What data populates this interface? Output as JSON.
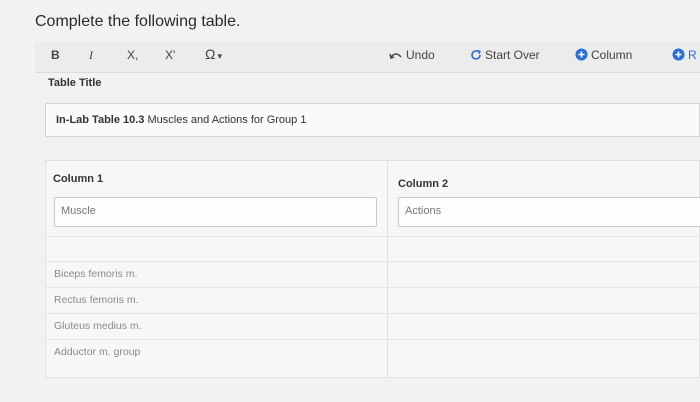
{
  "heading": "Complete the following table.",
  "toolbar": {
    "bold": "B",
    "italic": "I",
    "subscript": "X,",
    "superscript": "X'",
    "special_char": "Ω",
    "undo": "Undo",
    "start_over": "Start Over",
    "column": "Column",
    "more": "R"
  },
  "table_title_label": "Table Title",
  "table_title": {
    "bold_part": "In-Lab Table 10.3",
    "rest": " Muscles and Actions for Group 1"
  },
  "columns": [
    {
      "header": "Column 1",
      "value": "Muscle"
    },
    {
      "header": "Column 2",
      "value": "Actions"
    }
  ],
  "rows": [
    {
      "col1": "Biceps femoris m.",
      "col2": ""
    },
    {
      "col1": "Rectus femoris m.",
      "col2": ""
    },
    {
      "col1": "Gluteus medius m.",
      "col2": ""
    },
    {
      "col1": "Adductor m. group",
      "col2": ""
    }
  ],
  "colors": {
    "accent": "#2a6fd6",
    "background": "#f2f2f2"
  }
}
